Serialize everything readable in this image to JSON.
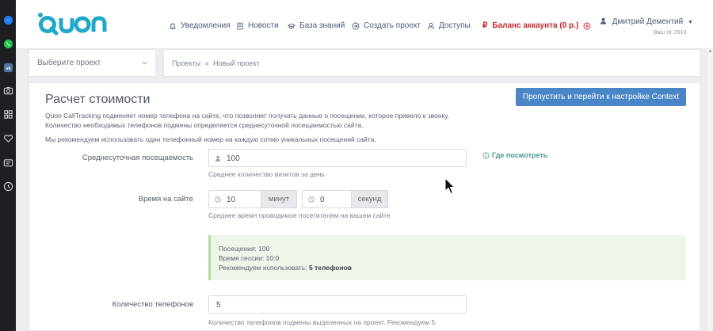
{
  "dock": {
    "icons": [
      "messenger-icon",
      "whatsapp-icon",
      "vk-icon",
      "camera-icon",
      "grid-icon",
      "heart-icon",
      "wallet-icon",
      "clock-icon"
    ]
  },
  "header": {
    "logo": "quon",
    "nav": {
      "notifications": "Уведомления",
      "news": "Новости",
      "knowledge": "База знаний",
      "create": "Создать проект",
      "access": "Доступы",
      "balance": "Баланс аккаунта (0 р.)"
    },
    "user_name": "Дмитрий Дементий",
    "user_id": "Ваш Id: 2910"
  },
  "selector": {
    "placeholder": "Выберите проект"
  },
  "breadcrumb": {
    "projects": "Проекты",
    "separator": "»",
    "current": "Новый проект"
  },
  "panel": {
    "title": "Расчет стоимости",
    "skip_button": "Пропустить и перейти к настройке Context",
    "desc_1": "Quon CallTracking подменяет номер телефона на сайте, что позволяет получать данные о посещении, которое привело к звонку.",
    "desc_2": "Количество необходимых телефонов подмены определяется среднесуточной посещаемостью сайта.",
    "desc_3": "Мы рекомендуем использовать один телефонный номер на каждую сотню уникальных посещений сайта.",
    "visits": {
      "label": "Среднесуточная посещаемость",
      "value": "100",
      "help": "Среднее количество визитов за день",
      "where": "Где посмотреть"
    },
    "time": {
      "label": "Время на сайте",
      "minutes": "10",
      "minutes_unit": "минут",
      "seconds": "0",
      "seconds_unit": "секунд",
      "help": "Среднее время проводимое посетителем на вашем сайте"
    },
    "result": {
      "visits": "Посещения: 100",
      "session": "Время сессии: 10:0",
      "recommend_prefix": "Рекомендуем использовать:",
      "recommend_value": "5 телефонов"
    },
    "phones": {
      "label": "Количество телефонов",
      "value": "5",
      "help": "Количество телефонов подмены выделенных на проект. Рекомендуем 5"
    }
  },
  "colors": {
    "brand": "#1fa8c7",
    "primary_button": "#4a86c7",
    "balance": "#c6262a",
    "nav": "#4a5a77",
    "result_bg": "#eef5ea",
    "result_border": "#b7d9a3",
    "link_green": "#4d9a8a"
  }
}
